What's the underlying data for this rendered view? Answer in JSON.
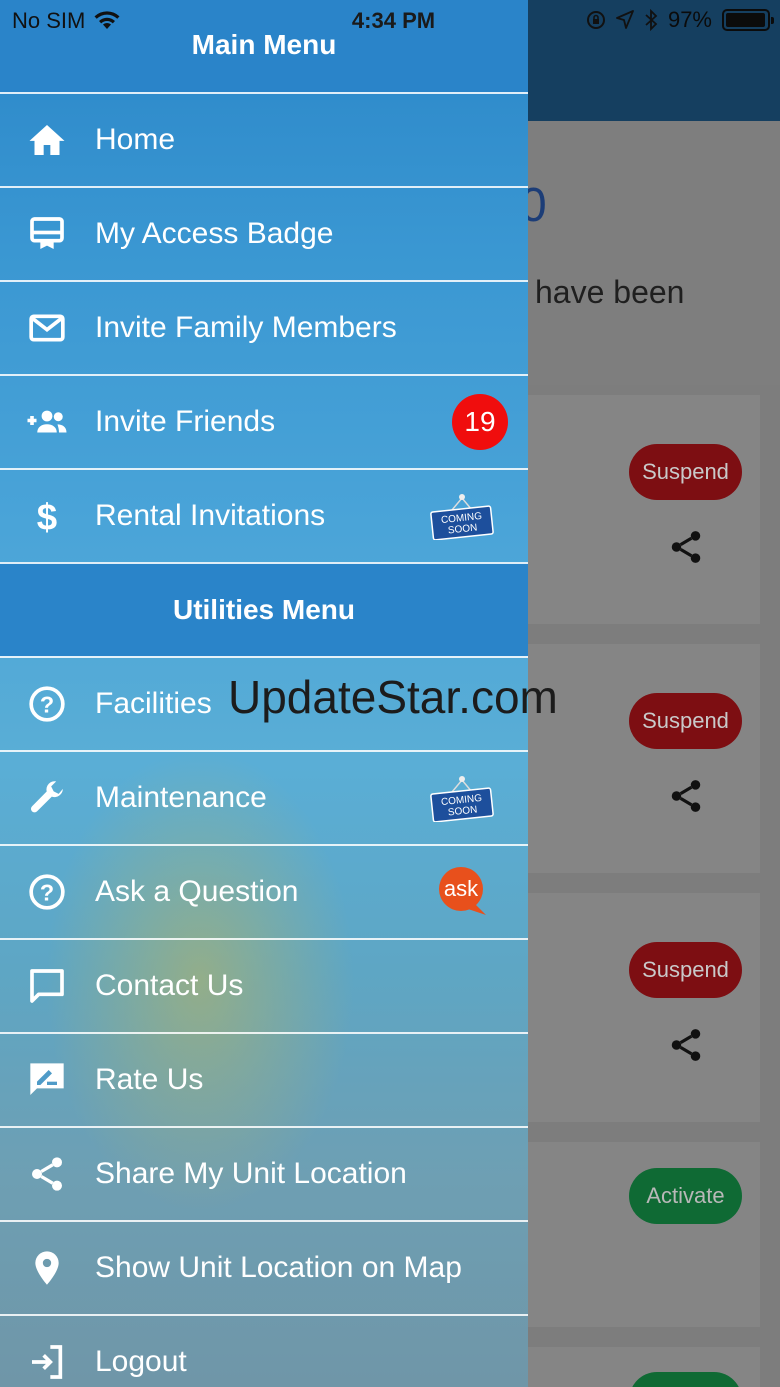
{
  "status_bar": {
    "carrier": "No SIM",
    "time": "4:34 PM",
    "battery": "97%",
    "battery_level": 0.97
  },
  "background_app": {
    "hero_partial_title": "0",
    "hero_partial_text": "have been",
    "cards": [
      {
        "action": "Suspend",
        "status": "red"
      },
      {
        "action": "Suspend",
        "status": "red"
      },
      {
        "action": "Suspend",
        "status": "red"
      },
      {
        "action": "Activate",
        "status": "green"
      }
    ]
  },
  "drawer": {
    "title": "Main Menu",
    "main_items": [
      {
        "label": "Home",
        "icon": "home-icon"
      },
      {
        "label": "My Access Badge",
        "icon": "badge-icon"
      },
      {
        "label": "Invite Family Members",
        "icon": "mail-icon"
      },
      {
        "label": "Invite Friends",
        "icon": "add-group-icon",
        "count": "19"
      },
      {
        "label": "Rental Invitations",
        "icon": "dollar-icon",
        "tag": "COMING SOON"
      }
    ],
    "utilities_title": "Utilities Menu",
    "utility_items": [
      {
        "label": "Facilities",
        "icon": "help-circle-icon"
      },
      {
        "label": "Maintenance",
        "icon": "wrench-icon",
        "tag": "COMING SOON"
      },
      {
        "label": "Ask a Question",
        "icon": "help-circle-icon",
        "tag": "ask"
      },
      {
        "label": "Contact Us",
        "icon": "chat-icon"
      },
      {
        "label": "Rate Us",
        "icon": "rate-icon"
      },
      {
        "label": "Share My Unit Location",
        "icon": "share-icon"
      },
      {
        "label": "Show Unit Location on Map",
        "icon": "location-pin-icon"
      },
      {
        "label": "Logout",
        "icon": "logout-icon"
      }
    ]
  },
  "watermark": "UpdateStar.com",
  "colors": {
    "drawer_header": "#2a84c9",
    "count_badge": "#f00d0d",
    "ask_badge": "#e8501c",
    "suspend": "#7d0e12",
    "activate": "#0f6a34"
  }
}
